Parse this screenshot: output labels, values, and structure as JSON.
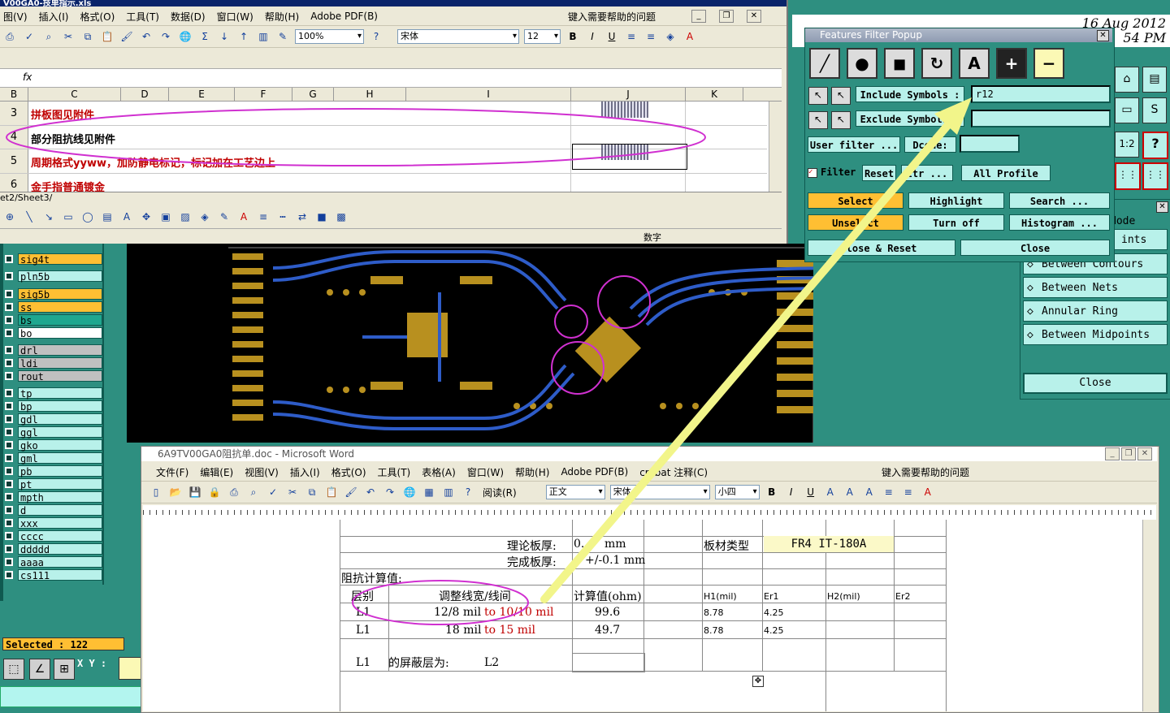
{
  "excel": {
    "title": "V00GA0-技单指示.xls",
    "menu": [
      "图(V)",
      "插入(I)",
      "格式(O)",
      "工具(T)",
      "数据(D)",
      "窗口(W)",
      "帮助(H)",
      "Adobe PDF(B)"
    ],
    "help_placeholder": "键入需要帮助的问题",
    "zoom": "100%",
    "font": "宋体",
    "font_size": "12",
    "columns": [
      "B",
      "C",
      "D",
      "E",
      "F",
      "G",
      "H",
      "I",
      "J",
      "K"
    ],
    "rows": [
      {
        "num": "3",
        "text": "拼板图见附件",
        "color": "#c00000"
      },
      {
        "num": "4",
        "text": "部分阻抗线见附件",
        "color": "#000000"
      },
      {
        "num": "5",
        "text": "周期格式yyww，加防静电标记，标记加在工艺边上",
        "color": "#c00000"
      },
      {
        "num": "6",
        "text": "金手指普通镀金",
        "color": "#c00000"
      }
    ],
    "sheet_tabs": "et2/Sheet3/",
    "status_text": "数字"
  },
  "layers": {
    "items": [
      {
        "name": "sig4t",
        "bg": "#ffbf33"
      },
      {
        "name": "pln5b",
        "bg": "#b8f1ea"
      },
      {
        "name": "sig5b",
        "bg": "#ffbf33"
      },
      {
        "name": "ss",
        "bg": "#ffbf33"
      },
      {
        "name": "bs",
        "bg": "#1fa78f"
      },
      {
        "name": "bo",
        "bg": "#ffffff"
      },
      {
        "name": "drl",
        "bg": "#c0c0c0"
      },
      {
        "name": "ldi",
        "bg": "#c0c0c0"
      },
      {
        "name": "rout",
        "bg": "#c0c0c0"
      },
      {
        "name": "tp",
        "bg": "#b8f1ea"
      },
      {
        "name": "bp",
        "bg": "#b8f1ea"
      },
      {
        "name": "gdl",
        "bg": "#b8f1ea"
      },
      {
        "name": "ggl",
        "bg": "#b8f1ea"
      },
      {
        "name": "gko",
        "bg": "#b8f1ea"
      },
      {
        "name": "gml",
        "bg": "#b8f1ea"
      },
      {
        "name": "pb",
        "bg": "#b8f1ea"
      },
      {
        "name": "pt",
        "bg": "#b8f1ea"
      },
      {
        "name": "mpth",
        "bg": "#b8f1ea"
      },
      {
        "name": "d",
        "bg": "#b8f1ea"
      },
      {
        "name": "xxx",
        "bg": "#b8f1ea"
      },
      {
        "name": "cccc",
        "bg": "#b8f1ea"
      },
      {
        "name": "ddddd",
        "bg": "#b8f1ea"
      },
      {
        "name": "aaaa",
        "bg": "#b8f1ea"
      },
      {
        "name": "cs111",
        "bg": "#b8f1ea"
      }
    ],
    "selected_label": "Selected : 122",
    "xy_label": "X Y :"
  },
  "filter": {
    "title": "Features Filter Popup",
    "include_label": "Include Symbols :",
    "include_value": "r12",
    "exclude_label": "Exclude Symbols :",
    "user_filter": "User filter ...",
    "dcode": "Dcode:",
    "filter_toggle": "Filter",
    "reset": "Reset",
    "attr": "ttr ...",
    "profile": "All Profile",
    "select": "Select",
    "highlight": "Highlight",
    "search": "Search ...",
    "unselect": "Unsel ct",
    "turn_off": "Turn off",
    "histogram": "Histogram ...",
    "close_reset": "lose & Reset",
    "close": "Close"
  },
  "right_panel": {
    "mode": "Node",
    "points": "ints",
    "items": [
      "Between Contours",
      "Between Nets",
      "Annular Ring",
      "Between Midpoints"
    ],
    "close": "Close",
    "date": "16 Aug 2012",
    "time": "54 PM"
  },
  "word": {
    "title": "6A9TV00GA0阻抗单.doc - Microsoft Word",
    "menu": [
      "文件(F)",
      "编辑(E)",
      "视图(V)",
      "插入(I)",
      "格式(O)",
      "工具(T)",
      "表格(A)",
      "窗口(W)",
      "帮助(H)",
      "Adobe PDF(B)",
      "crobat 注释(C)"
    ],
    "help_placeholder": "键入需要帮助的问题",
    "read_mode": "阅读(R)",
    "style": "正文",
    "font": "宋体",
    "size": "小四",
    "theory_thickness_label": "理论板厚:",
    "theory_thickness_value": "0.",
    "theory_unit": "mm",
    "board_type_label": "板材类型",
    "board_type_value": "FR4 IT-180A",
    "finished_thickness_label": "完成板厚:",
    "finished_thickness_value": "+/-0.1  mm",
    "impedance_calc": "阻抗计算值:",
    "headers": {
      "layer": "层别",
      "adjust": "调整线宽/线间",
      "calc": "计算值(ohm)",
      "h1": "H1(mil)",
      "er1": "Er1",
      "h2": "H2(mil)",
      "er2": "Er2"
    },
    "rows": [
      {
        "layer": "L1",
        "orig": "12/8 mil",
        "to": "to  10/10 mil",
        "calc": "99.6",
        "h1": "8.78",
        "er1": "4.25"
      },
      {
        "layer": "L1",
        "orig": "18  mil",
        "to": "to  15 mil",
        "calc": "49.7",
        "h1": "8.78",
        "er1": "4.25"
      }
    ],
    "shield_layer": "L1",
    "shield_label": "的屏蔽层为:",
    "shield_value": "L2"
  }
}
